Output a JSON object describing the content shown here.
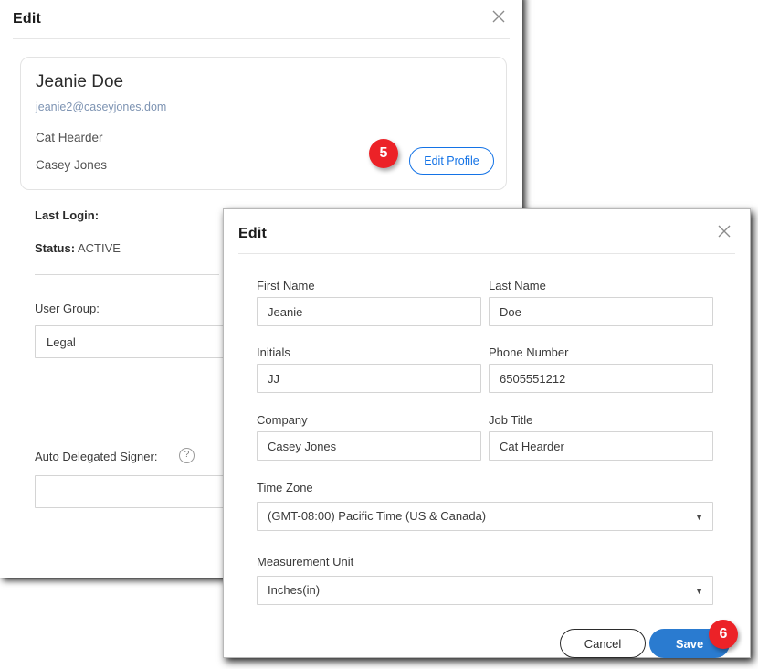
{
  "back_dialog": {
    "title": "Edit",
    "close_icon": "close-icon",
    "profile_card": {
      "name": "Jeanie Doe",
      "email": "jeanie2@caseyjones.dom",
      "job_title": "Cat Hearder",
      "company": "Casey Jones",
      "edit_profile_label": "Edit Profile",
      "edit_profile_color": "#1473e6"
    },
    "details": {
      "last_login_label": "Last Login:",
      "last_login_value": "",
      "status_label": "Status:",
      "status_value": "ACTIVE",
      "user_group_label": "User Group:",
      "user_group_value": "Legal",
      "auto_delegated_label": "Auto Delegated Signer:",
      "auto_delegated_help_icon": "help-circle-icon",
      "auto_delegated_value": ""
    }
  },
  "front_dialog": {
    "title": "Edit",
    "close_icon": "close-icon",
    "fields": {
      "first_name_label": "First Name",
      "first_name_value": "Jeanie",
      "last_name_label": "Last Name",
      "last_name_value": "Doe",
      "initials_label": "Initials",
      "initials_value": "JJ",
      "phone_label": "Phone Number",
      "phone_value": "6505551212",
      "company_label": "Company",
      "company_value": "Casey Jones",
      "job_title_label": "Job Title",
      "job_title_value": "Cat Hearder",
      "time_zone_label": "Time Zone",
      "time_zone_value": "(GMT-08:00) Pacific Time (US & Canada)",
      "measurement_unit_label": "Measurement Unit",
      "measurement_unit_value": "Inches(in)",
      "dropdown_caret_icon": "chevron-down-icon"
    },
    "footer": {
      "cancel_label": "Cancel",
      "save_label": "Save",
      "save_color": "#2a7bd0"
    }
  },
  "callouts": {
    "badge_color": "#ec2227",
    "step_5": "5",
    "step_6": "6"
  }
}
